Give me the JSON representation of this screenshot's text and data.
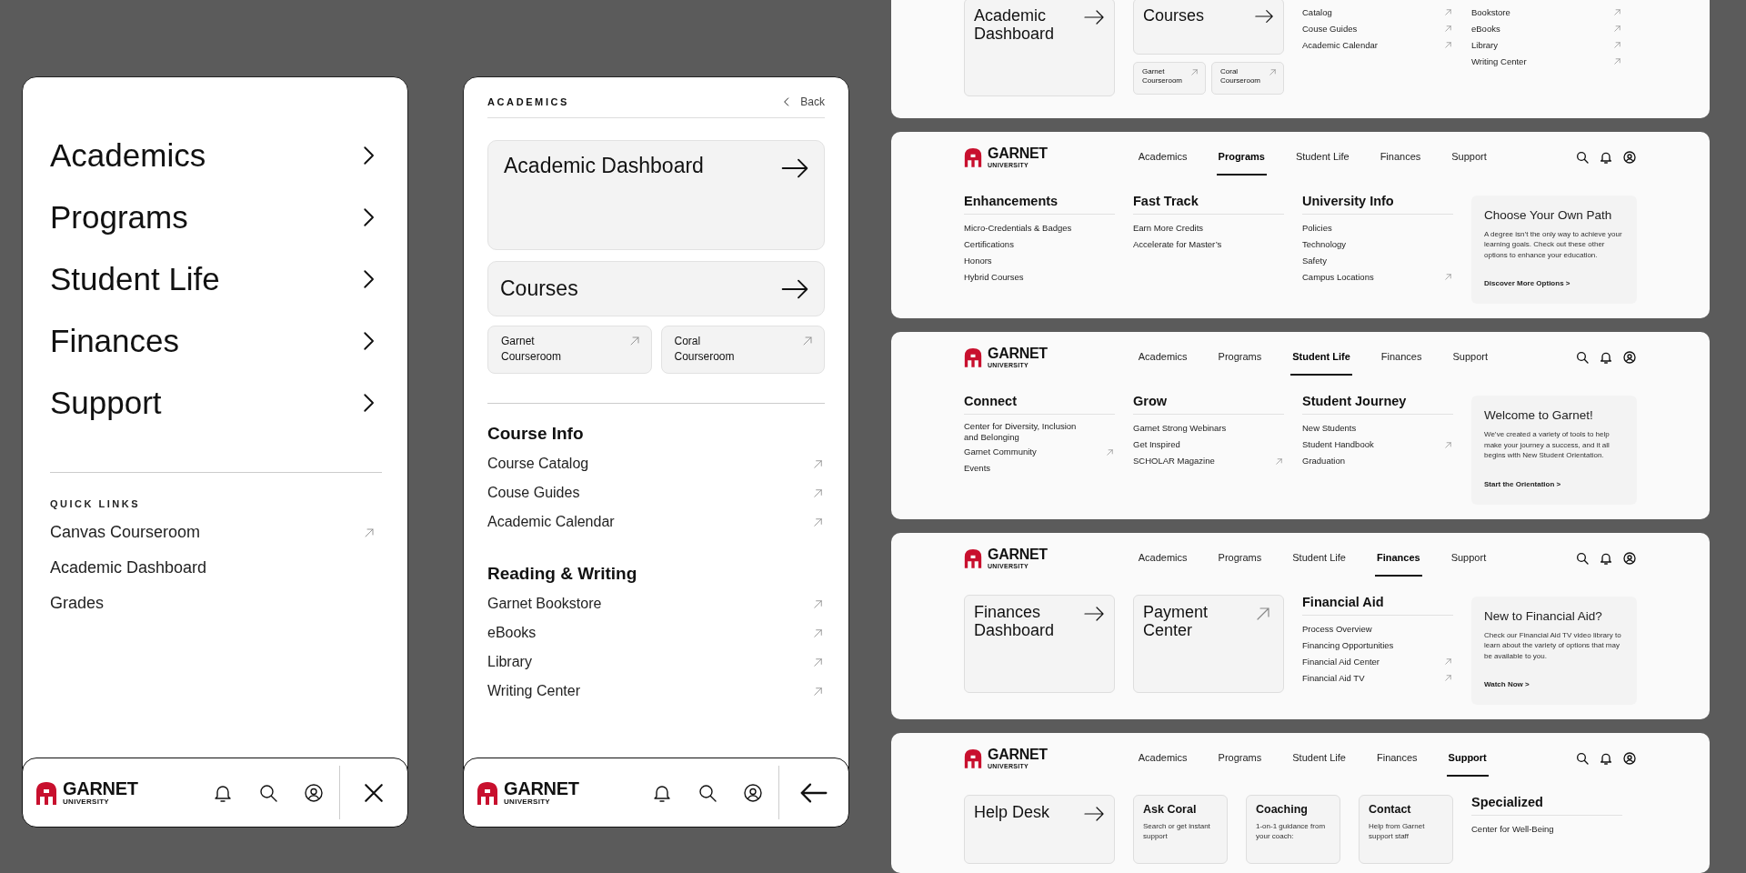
{
  "mobile_main": {
    "menu": [
      {
        "label": "Academics"
      },
      {
        "label": "Programs"
      },
      {
        "label": "Student Life"
      },
      {
        "label": "Finances"
      },
      {
        "label": "Support"
      }
    ],
    "quick_links_title": "QUICK LINKS",
    "quick_links": [
      {
        "label": "Canvas Courseroom",
        "external": true
      },
      {
        "label": "Academic Dashboard",
        "external": false
      },
      {
        "label": "Grades",
        "external": false
      }
    ],
    "bottom_bar": {
      "logo": {
        "name": "GARNET",
        "tagline": "UNIVERSITY"
      },
      "kind": "close"
    }
  },
  "mobile_academics": {
    "title": "ACADEMICS",
    "back": "Back",
    "cards": [
      {
        "label": "Academic Dashboard",
        "kind": "large"
      },
      {
        "label": "Courses",
        "kind": "medium"
      }
    ],
    "small_cards": [
      {
        "label": "Garnet Courseroom"
      },
      {
        "label": "Coral Courseroom"
      }
    ],
    "sections": [
      {
        "title": "Course Info",
        "links": [
          {
            "label": "Course Catalog",
            "external": true
          },
          {
            "label": "Couse Guides",
            "external": true
          },
          {
            "label": "Academic Calendar",
            "external": true
          }
        ]
      },
      {
        "title": "Reading & Writing",
        "links": [
          {
            "label": "Garnet Bookstore",
            "external": true
          },
          {
            "label": "eBooks",
            "external": true
          },
          {
            "label": "Library",
            "external": true
          },
          {
            "label": "Writing Center",
            "external": true
          }
        ]
      }
    ],
    "bottom_bar": {
      "logo": {
        "name": "GARNET",
        "tagline": "UNIVERSITY"
      },
      "kind": "back"
    }
  },
  "desktop_menus": [
    {
      "blocks": [
        {
          "kind": "card",
          "label": "Academic Dashboard",
          "external": false
        },
        {
          "kind": "stack",
          "card": {
            "label": "Courses",
            "external": false
          },
          "small_cards": [
            {
              "label": "Garnet Courseroom",
              "external": true
            },
            {
              "label": "Coral Courseroom",
              "external": true
            }
          ]
        },
        {
          "kind": "column",
          "links": [
            {
              "label": "Catalog",
              "external": true
            },
            {
              "label": "Couse Guides",
              "external": true
            },
            {
              "label": "Academic Calendar",
              "external": true
            }
          ]
        },
        {
          "kind": "column",
          "links": [
            {
              "label": "Bookstore",
              "external": true
            },
            {
              "label": "eBooks",
              "external": true
            },
            {
              "label": "Library",
              "external": true
            },
            {
              "label": "Writing Center",
              "external": true
            }
          ]
        }
      ]
    },
    {
      "logo": {
        "name": "GARNET",
        "tagline": "UNIVERSITY"
      },
      "nav": [
        {
          "label": "Academics",
          "selected": false
        },
        {
          "label": "Programs",
          "selected": true
        },
        {
          "label": "Student Life",
          "selected": false
        },
        {
          "label": "Finances",
          "selected": false
        },
        {
          "label": "Support",
          "selected": false
        }
      ],
      "blocks": [
        {
          "kind": "column",
          "title": "Enhancements",
          "links": [
            {
              "label": "Micro-Credentials & Badges",
              "external": false
            },
            {
              "label": "Certifications",
              "external": false
            },
            {
              "label": "Honors",
              "external": false
            },
            {
              "label": "Hybrid Courses",
              "external": false
            }
          ]
        },
        {
          "kind": "column",
          "title": "Fast Track",
          "links": [
            {
              "label": "Earn More Credits",
              "external": false
            },
            {
              "label": "Accelerate for Master’s",
              "external": false
            }
          ]
        },
        {
          "kind": "column",
          "title": "University Info",
          "links": [
            {
              "label": "Policies",
              "external": false
            },
            {
              "label": "Technology",
              "external": false
            },
            {
              "label": "Safety",
              "external": false
            },
            {
              "label": "Campus Locations",
              "external": true
            }
          ]
        },
        {
          "kind": "promo",
          "title": "Choose Your Own Path",
          "text": "A degree isn’t the only way to achieve your learning goals. Check out these other options to enhance your education.",
          "link": "Discover More Options >"
        }
      ]
    },
    {
      "logo": {
        "name": "GARNET",
        "tagline": "UNIVERSITY"
      },
      "nav": [
        {
          "label": "Academics",
          "selected": false
        },
        {
          "label": "Programs",
          "selected": false
        },
        {
          "label": "Student Life",
          "selected": true
        },
        {
          "label": "Finances",
          "selected": false
        },
        {
          "label": "Support",
          "selected": false
        }
      ],
      "blocks": [
        {
          "kind": "column",
          "title": "Connect",
          "links": [
            {
              "label": "Center for Diversity, Inclusion and Belonging",
              "external": false
            },
            {
              "label": "Garnet Community",
              "external": true
            },
            {
              "label": "Events",
              "external": false
            }
          ]
        },
        {
          "kind": "column",
          "title": "Grow",
          "links": [
            {
              "label": "Garnet Strong Webinars",
              "external": false
            },
            {
              "label": "Get Inspired",
              "external": false
            },
            {
              "label": "SCHOLAR Magazine",
              "external": true
            }
          ]
        },
        {
          "kind": "column",
          "title": "Student Journey",
          "links": [
            {
              "label": "New Students",
              "external": false
            },
            {
              "label": "Student Handbook",
              "external": true
            },
            {
              "label": "Graduation",
              "external": false
            }
          ]
        },
        {
          "kind": "promo",
          "title": "Welcome to Garnet!",
          "text": "We’ve created a variety of tools to help make your journey a success, and it all begins with New Student Orientation.",
          "link": "Start the Orientation >"
        }
      ]
    },
    {
      "logo": {
        "name": "GARNET",
        "tagline": "UNIVERSITY"
      },
      "nav": [
        {
          "label": "Academics",
          "selected": false
        },
        {
          "label": "Programs",
          "selected": false
        },
        {
          "label": "Student Life",
          "selected": false
        },
        {
          "label": "Finances",
          "selected": true
        },
        {
          "label": "Support",
          "selected": false
        }
      ],
      "blocks": [
        {
          "kind": "card",
          "label": "Finances Dashboard",
          "external": false
        },
        {
          "kind": "card",
          "label": "Payment Center",
          "external": true
        },
        {
          "kind": "column",
          "title": "Financial Aid",
          "links": [
            {
              "label": "Process Overview",
              "external": false
            },
            {
              "label": "Financing Opportunities",
              "external": false
            },
            {
              "label": "Financial Aid Center",
              "external": true
            },
            {
              "label": "Financial Aid TV",
              "external": true
            }
          ]
        },
        {
          "kind": "promo",
          "title": "New to Financial Aid?",
          "text": "Check our Financial Aid TV video library to learn about the variety of options that may be available to you.",
          "link": "Watch Now >"
        }
      ]
    },
    {
      "logo": {
        "name": "GARNET",
        "tagline": "UNIVERSITY"
      },
      "nav": [
        {
          "label": "Academics",
          "selected": false
        },
        {
          "label": "Programs",
          "selected": false
        },
        {
          "label": "Student Life",
          "selected": false
        },
        {
          "label": "Finances",
          "selected": false
        },
        {
          "label": "Support",
          "selected": true
        }
      ],
      "blocks": [
        {
          "kind": "card",
          "label": "Help Desk",
          "external": false
        },
        {
          "kind": "info",
          "title": "Ask Coral",
          "text": "Search or get instant support"
        },
        {
          "kind": "info",
          "title": "Coaching",
          "text": "1-on-1 guidance from your coach:"
        },
        {
          "kind": "info",
          "title": "Contact",
          "text": "Help from Garnet support staff"
        },
        {
          "kind": "column",
          "title": "Specialized",
          "links": [
            {
              "label": "Center for Well-Being",
              "external": false
            }
          ]
        }
      ]
    }
  ]
}
